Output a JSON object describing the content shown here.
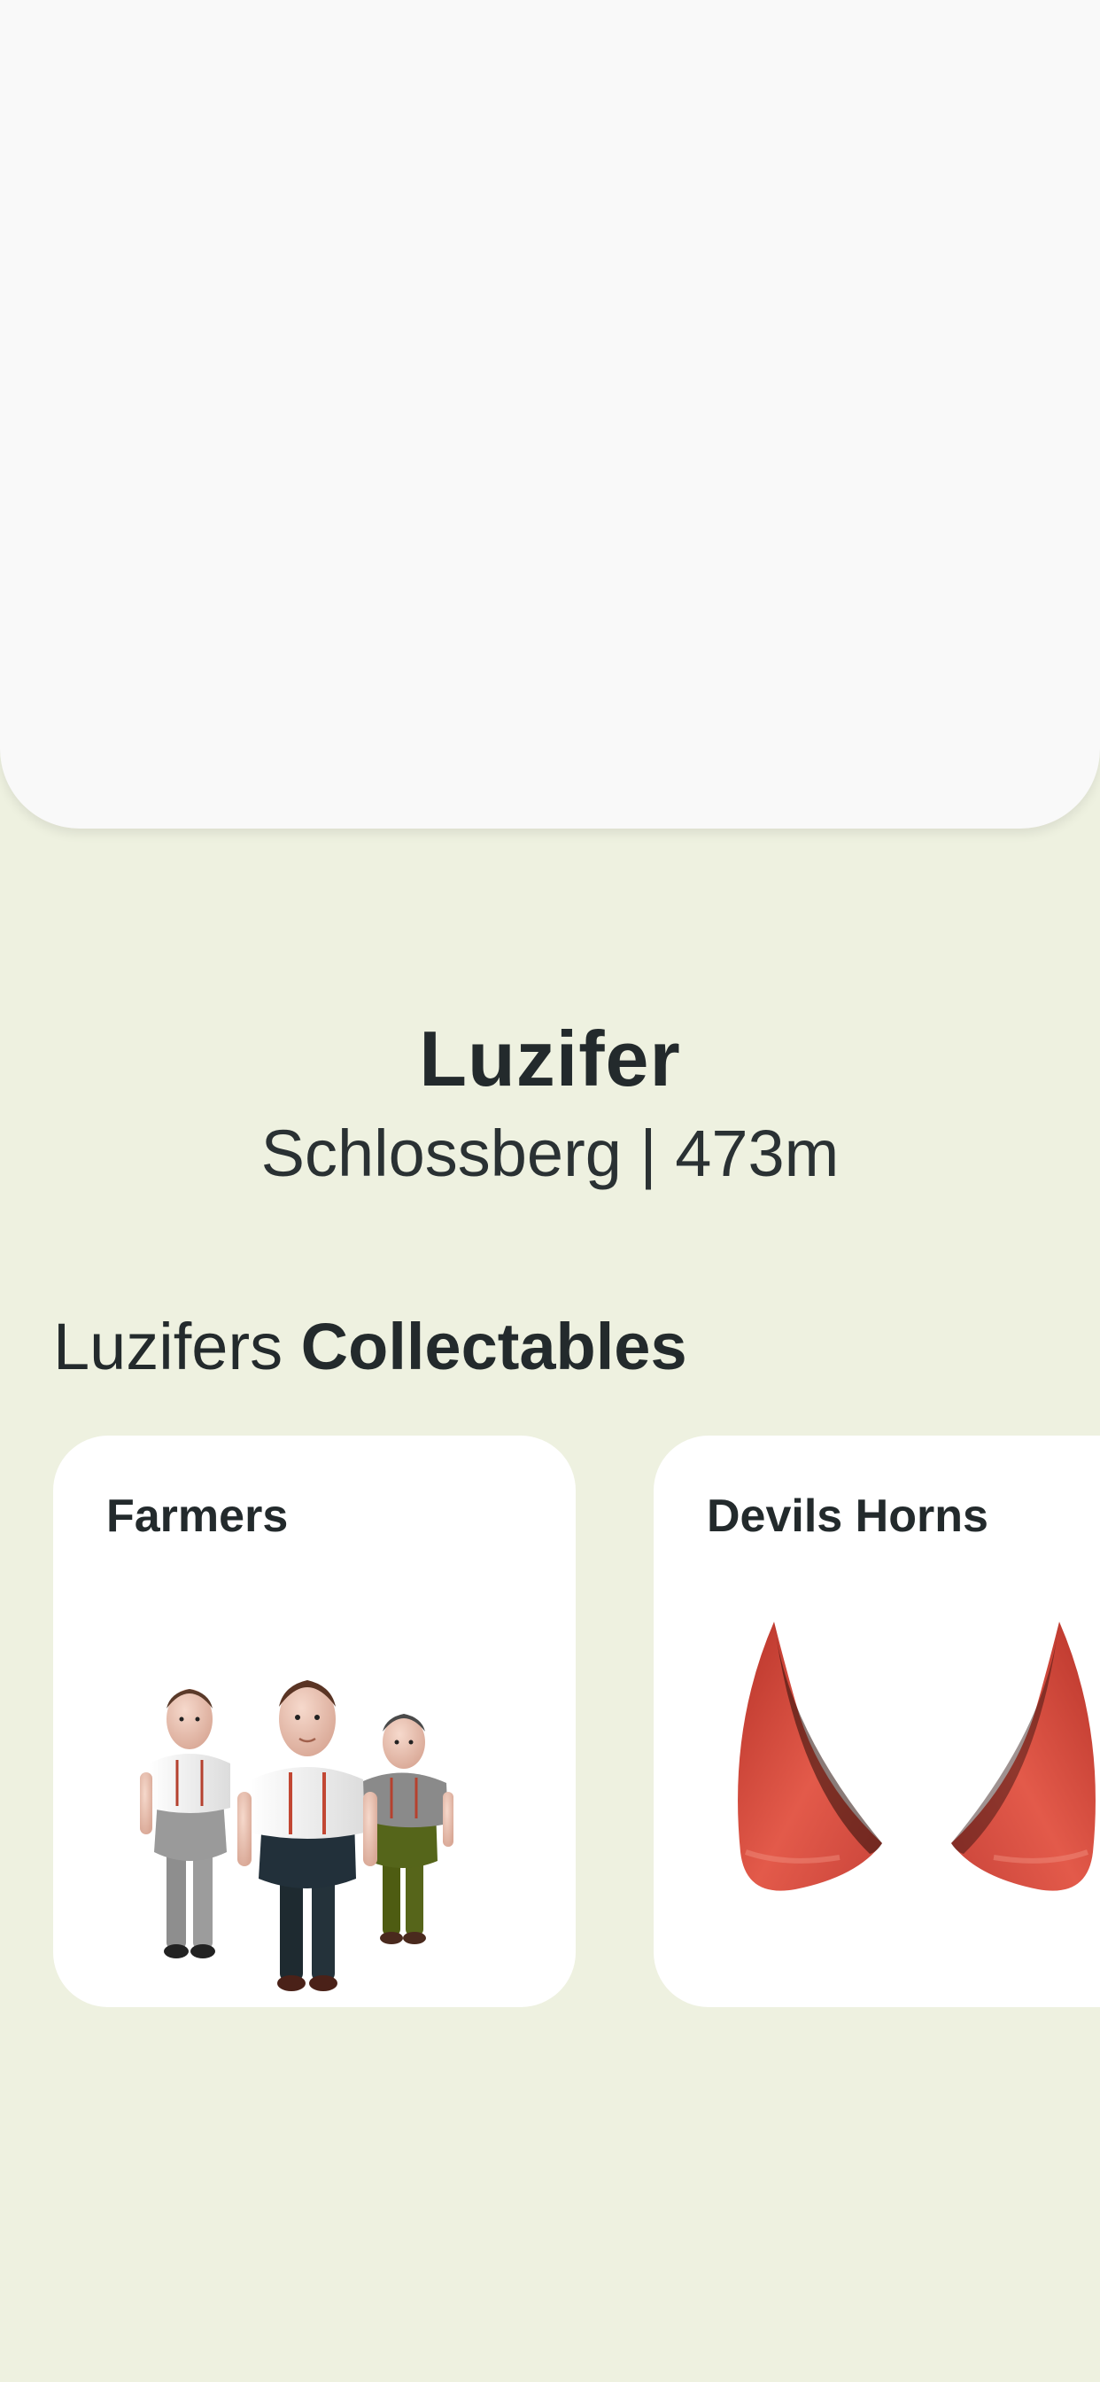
{
  "place": {
    "name": "Luzifer",
    "subtitle": "Schlossberg | 473m"
  },
  "collectables": {
    "heading_prefix": "Luzifers",
    "heading_emphasis": "Collectables",
    "items": [
      {
        "title": "Farmers",
        "image": "farmers-figures"
      },
      {
        "title": "Devils Horns",
        "image": "devil-horns"
      }
    ]
  },
  "colors": {
    "background": "#EEF1E0",
    "panel": "#F9F9F9",
    "card": "#FFFFFF",
    "text": "#232A2C",
    "horn_red": "#D9483B"
  }
}
